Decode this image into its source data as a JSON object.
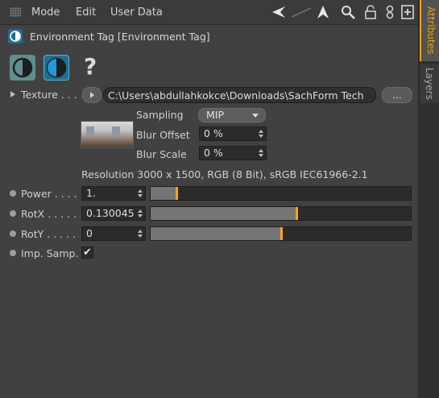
{
  "menubar": {
    "items": [
      "Mode",
      "Edit",
      "User Data"
    ],
    "icons": [
      "back-arrow-icon",
      "forward-arrow-icon",
      "up-arrow-icon",
      "search-icon",
      "lock-icon",
      "link-icon",
      "new-panel-icon"
    ]
  },
  "header": {
    "title": "Environment Tag [Environment Tag]",
    "help_glyph": "?"
  },
  "texture": {
    "label": "Texture . . .",
    "path": "C:\\Users\\abdullahkokce\\Downloads\\SachForm Tech",
    "browse_label": "...",
    "sampling_label": "Sampling",
    "sampling_value": "MIP",
    "blur_offset_label": "Blur Offset",
    "blur_offset_value": "0 %",
    "blur_scale_label": "Blur Scale",
    "blur_scale_value": "0 %",
    "resolution_text": "Resolution 3000 x 1500, RGB (8 Bit), sRGB IEC61966-2.1"
  },
  "params": [
    {
      "label": "Power . . . .",
      "value": "1.",
      "level": 0.1
    },
    {
      "label": "RotX . . . . .",
      "value": "0.130045",
      "level": 0.56
    },
    {
      "label": "RotY . . . . .",
      "value": "0",
      "level": 0.5
    }
  ],
  "imp_samp": {
    "label": "Imp. Samp.",
    "checked": "✔"
  },
  "sidebar": {
    "tabs": [
      "Attributes",
      "Layers"
    ]
  },
  "colors": {
    "accent": "#f3a616",
    "tab_active": "#e8a31a",
    "icon_blue": "#1f9ad6",
    "icon_teal": "#5f8f8c"
  }
}
